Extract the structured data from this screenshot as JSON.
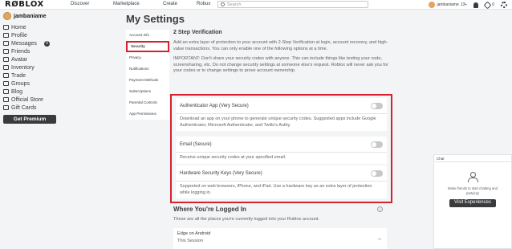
{
  "topbar": {
    "logo": "RØBLOX",
    "nav": [
      "Discover",
      "Marketplace",
      "Create",
      "Robux"
    ],
    "search_placeholder": "Search",
    "username": "jambaniame",
    "age_label": "13+",
    "robux_count": "0"
  },
  "sidebar": {
    "username": "jambaniame",
    "items": [
      {
        "label": "Home",
        "icon": "home-icon"
      },
      {
        "label": "Profile",
        "icon": "profile-icon"
      },
      {
        "label": "Messages",
        "icon": "messages-icon",
        "badge": "0"
      },
      {
        "label": "Friends",
        "icon": "friends-icon"
      },
      {
        "label": "Avatar",
        "icon": "avatar-icon"
      },
      {
        "label": "Inventory",
        "icon": "inventory-icon"
      },
      {
        "label": "Trade",
        "icon": "trade-icon"
      },
      {
        "label": "Groups",
        "icon": "groups-icon"
      },
      {
        "label": "Blog",
        "icon": "blog-icon"
      },
      {
        "label": "Official Store",
        "icon": "store-icon"
      },
      {
        "label": "Gift Cards",
        "icon": "giftcard-icon"
      }
    ],
    "premium_label": "Get Premium"
  },
  "page": {
    "title": "My Settings"
  },
  "settings_nav": [
    "Account Info",
    "Security",
    "Privacy",
    "Notifications",
    "Payment Methods",
    "Subscriptions",
    "Parental Controls",
    "App Permissions"
  ],
  "two_step": {
    "title": "2 Step Verification",
    "intro": "Add an extra layer of protection to your account with 2-Step Verification at login, account recovery, and high-value transactions. You can only enable one of the following options at a time.",
    "important": "IMPORTANT: Don't share your security codes with anyone. This can include things like texting your code, screensharing, etc. Do not change security settings at someone else's request. Roblox will never ask you for your codes or to change settings to prove account ownership.",
    "options": [
      {
        "title": "Authenticator App (Very Secure)",
        "desc": "Download an app on your phone to generate unique security codes. Suggested apps include Google Authenticator, Microsoft Authenticator, and Twilio's Authy.",
        "enabled": false
      },
      {
        "title": "Email (Secure)",
        "desc": "Receive unique security codes at your specified email.",
        "enabled": false
      },
      {
        "title": "Hardware Security Keys (Very Secure)",
        "desc": "Supported on web browsers, iPhone, and iPad. Use a hardware key as an extra layer of protection while logging in.",
        "enabled": false
      }
    ]
  },
  "logged_in": {
    "title": "Where You're Logged In",
    "desc": "These are all the places you're currently logged into your Roblox account.",
    "device": "Edge on Android",
    "session": "This Session"
  },
  "chat": {
    "title": "Chat",
    "message": "Make friends to start chatting and partying!",
    "button": "Visit Experiences"
  },
  "colors": {
    "highlight": "#d62230",
    "dark": "#393b3d"
  }
}
